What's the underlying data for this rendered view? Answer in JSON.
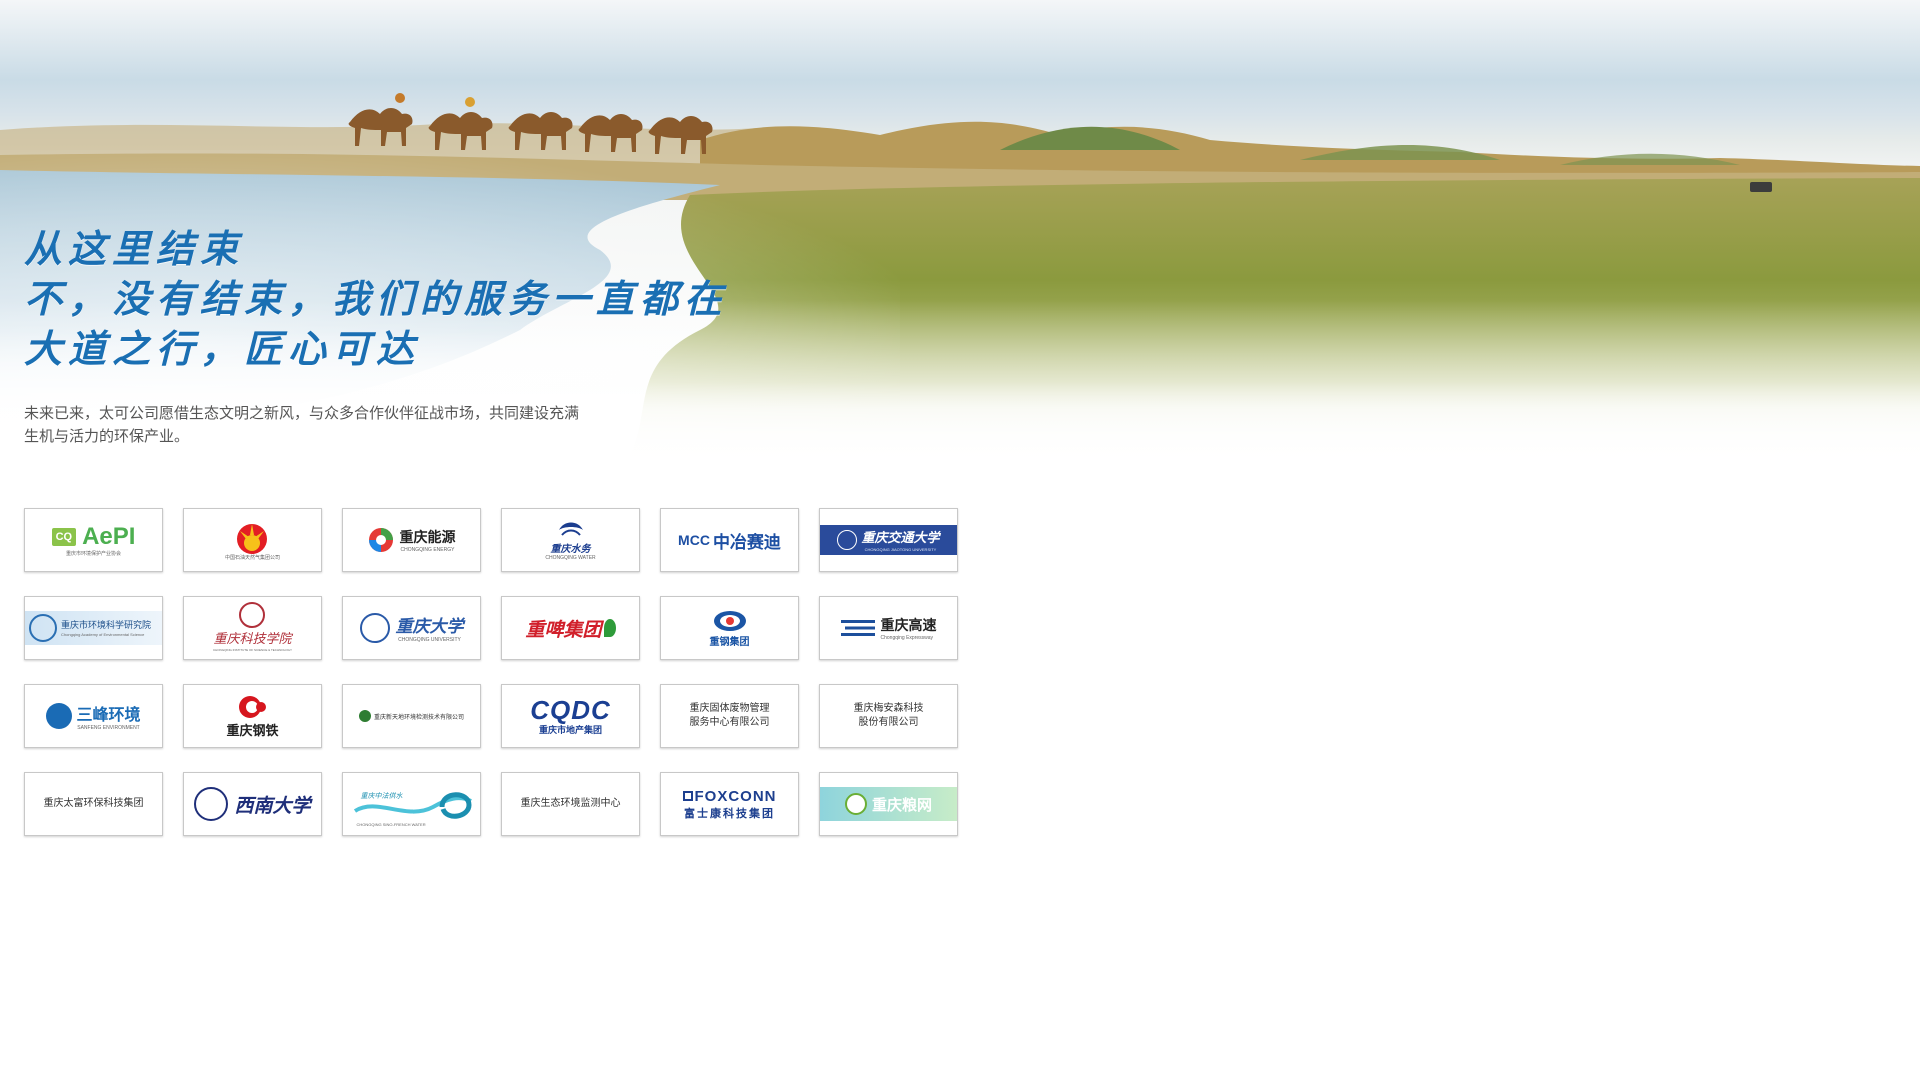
{
  "hero": {
    "headline_lines": [
      "从这里结束",
      "不，没有结束，我们的服务一直都在",
      "大道之行，匠心可达"
    ],
    "subtitle": "未来已来，太可公司愿借生态文明之新风，与众多合作伙伴征战市场，共同建设充满\n生机与活力的环保产业。"
  },
  "logos": [
    {
      "name": "cq-aepi",
      "text": "AePI",
      "sub": "重庆市环境保护产业协会",
      "color": "#4caf50"
    },
    {
      "name": "cnpc",
      "text": "",
      "sub": "中国石油天然气集团公司",
      "color": "#e31e24"
    },
    {
      "name": "chongqing-energy",
      "text": "重庆能源",
      "sub": "CHONGQING ENERGY",
      "color": "#222222"
    },
    {
      "name": "chongqing-water",
      "text": "重庆水务",
      "sub": "CHONGQING WATER",
      "color": "#1b3d8f"
    },
    {
      "name": "mcc-cisdi",
      "text": "中冶赛迪",
      "sub": "MCC",
      "color": "#1d4fa3"
    },
    {
      "name": "chongqing-jiaotong-university",
      "text": "重庆交通大学",
      "sub": "CHONGQING JIAOTONG UNIVERSITY",
      "color": "#2a4b9b"
    },
    {
      "name": "cq-academy-environmental-science",
      "text": "重庆市环境科学研究院",
      "sub": "Chongqing Academy of Environmental Science",
      "color": "#2a6fb3"
    },
    {
      "name": "chongqing-academy-science-technology",
      "text": "重庆科技学院",
      "sub": "CHONGQING INSTITUTE OF SCIENCE & TECHNOLOGY",
      "color": "#b0303a"
    },
    {
      "name": "chongqing-university",
      "text": "重庆大学",
      "sub": "CHONGQING UNIVERSITY",
      "color": "#2a5aa8"
    },
    {
      "name": "chongqing-brewery-group",
      "text": "重啤集团",
      "sub": "",
      "color": "#d11f2a"
    },
    {
      "name": "chongqing-iron-steel-group",
      "text": "重钢集团",
      "sub": "",
      "color": "#1b55a5"
    },
    {
      "name": "chongqing-expressway",
      "text": "重庆高速",
      "sub": "Chongqing Expressway",
      "color": "#1d4f9c"
    },
    {
      "name": "sanfeng-environment",
      "text": "三峰环境",
      "sub": "SANFENG ENVIRONMENT",
      "color": "#1a6bb5"
    },
    {
      "name": "chongqing-steel",
      "text": "重庆钢铁",
      "sub": "",
      "color": "#d6161e"
    },
    {
      "name": "chongqing-xintianyi",
      "text": "重庆新天地环境检测技术有限公司",
      "sub": "",
      "color": "#333333"
    },
    {
      "name": "cqdc",
      "text": "CQDC",
      "sub": "重庆市地产集团",
      "color": "#1b3f92"
    },
    {
      "name": "chongqing-solid-waste-center",
      "text": "重庆固体废物管理\n服务中心有限公司",
      "sub": "",
      "color": "#333333"
    },
    {
      "name": "chongqing-meiansen",
      "text": "重庆梅安森科技\n股份有限公司",
      "sub": "",
      "color": "#333333"
    },
    {
      "name": "chongqing-taifu",
      "text": "重庆太富环保科技集团",
      "sub": "",
      "color": "#333333"
    },
    {
      "name": "southwest-university",
      "text": "西南大学",
      "sub": "",
      "color": "#1f2f7a"
    },
    {
      "name": "chongqing-zhongfa-water",
      "text": "重庆中法供水",
      "sub": "CHONGQING SINO-FRENCH WATER",
      "color": "#1b8fb0"
    },
    {
      "name": "chongqing-eco-monitoring",
      "text": "重庆生态环境监测中心",
      "sub": "",
      "color": "#333333"
    },
    {
      "name": "foxconn",
      "text": "FOXCONN",
      "sub": "富士康科技集团",
      "color": "#1d3f8f"
    },
    {
      "name": "chongqing-grain",
      "text": "重庆粮网",
      "sub": "",
      "color": "#ffffff"
    }
  ],
  "colors": {
    "headline": "#1a6fb3",
    "subtitle": "#555555",
    "card_border": "#c8c8c8"
  }
}
